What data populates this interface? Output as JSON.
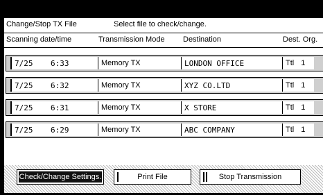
{
  "header": {
    "title": "Change/Stop TX File",
    "message": "Select file to check/change."
  },
  "columns": {
    "scan": "Scanning date/time",
    "mode": "Transmission Mode",
    "dest": "Destination",
    "destorg": "Dest. Org."
  },
  "rows": [
    {
      "date": "7/25",
      "time": "6:33",
      "mode": "Memory TX",
      "destination": "LONDON OFFICE",
      "dest": "Ttl",
      "org": "1"
    },
    {
      "date": "7/25",
      "time": "6:32",
      "mode": "Memory TX",
      "destination": "XYZ CO.LTD",
      "dest": "Ttl",
      "org": "1"
    },
    {
      "date": "7/25",
      "time": "6:31",
      "mode": "Memory TX",
      "destination": "X STORE",
      "dest": "Ttl",
      "org": "1"
    },
    {
      "date": "7/25",
      "time": "6:29",
      "mode": "Memory TX",
      "destination": "ABC COMPANY",
      "dest": "Ttl",
      "org": "1"
    }
  ],
  "buttons": {
    "check": "Check/Change Settings.",
    "print": "Print File",
    "stop": "Stop Transmission"
  }
}
